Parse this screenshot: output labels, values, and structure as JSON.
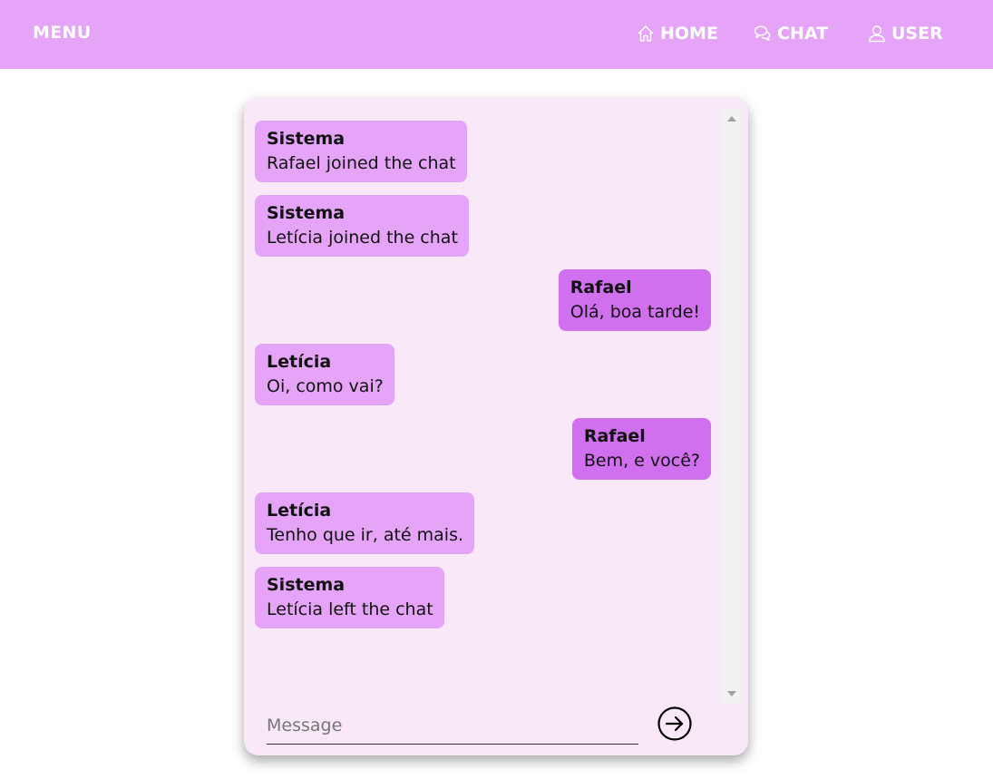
{
  "nav": {
    "menu_label": "MENU",
    "items": [
      {
        "label": "HOME",
        "icon": "home-icon"
      },
      {
        "label": "CHAT",
        "icon": "chat-icon"
      },
      {
        "label": "USER",
        "icon": "user-icon"
      }
    ]
  },
  "chat": {
    "messages": [
      {
        "author": "Sistema",
        "text": "Rafael joined the chat",
        "side": "left"
      },
      {
        "author": "Sistema",
        "text": "Letícia joined the chat",
        "side": "left"
      },
      {
        "author": "Rafael",
        "text": "Olá, boa tarde!",
        "side": "right"
      },
      {
        "author": "Letícia",
        "text": "Oi, como vai?",
        "side": "left"
      },
      {
        "author": "Rafael",
        "text": "Bem, e você?",
        "side": "right"
      },
      {
        "author": "Letícia",
        "text": "Tenho que ir, até mais.",
        "side": "left"
      },
      {
        "author": "Sistema",
        "text": "Letícia left the chat",
        "side": "left"
      }
    ],
    "input": {
      "placeholder": "Message",
      "value": ""
    },
    "send_icon": "arrow-right-circle-icon"
  },
  "colors": {
    "navbar": "#e6a4f8",
    "bubble_other": "#e6a4f8",
    "bubble_self": "#d070ee",
    "card_background": "#f8e8f8"
  }
}
